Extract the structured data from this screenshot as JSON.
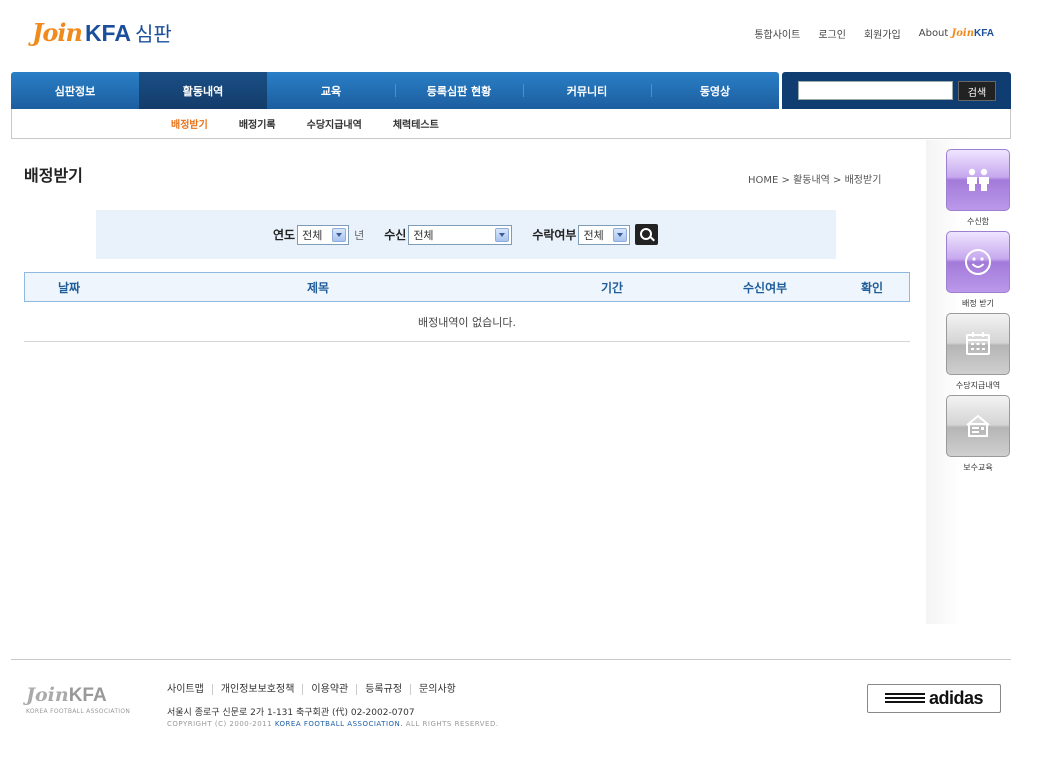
{
  "header": {
    "logo_join": "Join",
    "logo_kfa": "KFA",
    "logo_suffix": "심판",
    "links": [
      "통합사이트",
      "로그인",
      "회원가입"
    ],
    "about_text": "About",
    "about_join": "Join",
    "about_kfa": "KFA"
  },
  "nav": {
    "items": [
      "심판정보",
      "활동내역",
      "교육",
      "등록심판 현황",
      "커뮤니티",
      "동영상"
    ],
    "active_index": 1,
    "search_button": "검색"
  },
  "subnav": {
    "items": [
      "배정받기",
      "배정기록",
      "수당지급내역",
      "체력테스트"
    ],
    "active_index": 0
  },
  "page": {
    "title": "배정받기",
    "breadcrumb": "HOME > 활동내역 > 배정받기"
  },
  "filter": {
    "year_label": "연도",
    "year_value": "전체",
    "year_unit": "년",
    "receive_label": "수신",
    "receive_value": "전체",
    "accept_label": "수락여부",
    "accept_value": "전체"
  },
  "table": {
    "headers": [
      "날짜",
      "제목",
      "기간",
      "수신여부",
      "확인"
    ],
    "empty_message": "배정내역이 없습니다."
  },
  "quick_menu": [
    {
      "label": "수신함",
      "icon": "people-icon",
      "style": "purple"
    },
    {
      "label": "배정 받기",
      "icon": "smile-icon",
      "style": "purple"
    },
    {
      "label": "수당지급내역",
      "icon": "calendar-icon",
      "style": "gray"
    },
    {
      "label": "보수교육",
      "icon": "education-icon",
      "style": "gray"
    }
  ],
  "footer": {
    "logo_join": "Join",
    "logo_kfa": "KFA",
    "logo_sub": "KOREA FOOTBALL ASSOCIATION",
    "links": [
      "사이트맵",
      "개인정보보호정책",
      "이용약관",
      "등록규정",
      "문의사항"
    ],
    "address": "서울시 종로구 신문로 2가 1-131 축구회관 (代) 02-2002-0707",
    "copyright_prefix": "COPYRIGHT (C) 2000-2011",
    "copyright_org": "KOREA FOOTBALL ASSOCIATION.",
    "copyright_suffix": "ALL RIGHTS RESERVED.",
    "sponsor": "adidas"
  },
  "colors": {
    "nav_blue": "#1c5e9f",
    "nav_active": "#133c6a",
    "accent_orange": "#e8731b",
    "filter_bg": "#e9f2fb",
    "header_text_blue": "#1f5d9a"
  }
}
